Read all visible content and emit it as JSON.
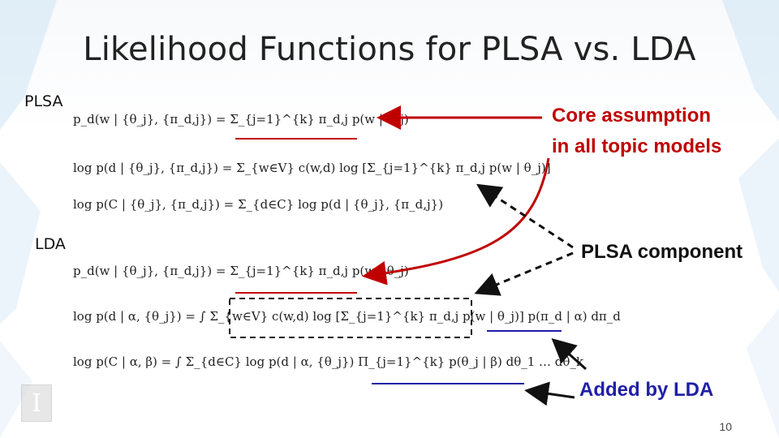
{
  "slide": {
    "title": "Likelihood Functions for PLSA vs. LDA",
    "page_number": "10",
    "sections": {
      "plsa": "PLSA",
      "lda": "LDA"
    },
    "callouts": {
      "core_line1": "Core assumption",
      "core_line2": "in all topic models",
      "plsa_component": "PLSA component",
      "added_by_lda": "Added by LDA"
    },
    "equations": {
      "plsa_1": "p_d(w | {θ_j}, {π_d,j}) = Σ_{j=1}^{k} π_d,j p(w | θ_j)",
      "plsa_2": "log p(d | {θ_j}, {π_d,j}) = Σ_{w∈V} c(w,d) log [Σ_{j=1}^{k} π_d,j p(w | θ_j)]",
      "plsa_3": "log p(C | {θ_j}, {π_d,j}) = Σ_{d∈C} log p(d | {θ_j}, {π_d,j})",
      "lda_1": "p_d(w | {θ_j}, {π_d,j}) = Σ_{j=1}^{k} π_d,j p(w | θ_j)",
      "lda_2": "log p(d | α, {θ_j}) = ∫ Σ_{w∈V} c(w,d) log [Σ_{j=1}^{k} π_d,j p(w | θ_j)] p(π_d | α) dπ_d",
      "lda_3": "log p(C | α, β) = ∫ Σ_{d∈C} log p(d | α, {θ_j}) Π_{j=1}^{k} p(θ_j | β) dθ_1 … dθ_k"
    },
    "colors": {
      "red": "#c00000",
      "blue": "#1f1fa8",
      "black": "#111111"
    },
    "logo_icon": "university-logo-icon"
  }
}
